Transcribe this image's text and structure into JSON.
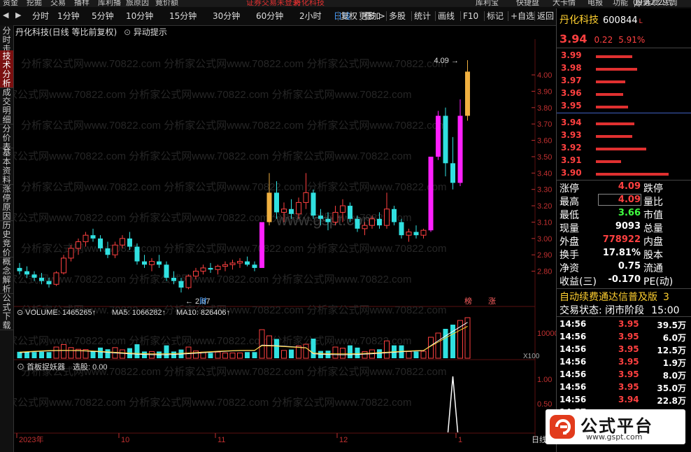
{
  "menu": [
    "资金",
    "挖掘",
    "交易",
    "播样",
    "库利播",
    "旅原因",
    "竟价额",
    "证券交易未登录",
    "丹化科技",
    "库利宝",
    "快捷盘",
    "大卡情",
    "电报",
    "功能",
    "服务",
    "公式",
    "选项",
    "09:42:29 周日"
  ],
  "toolbar": {
    "periods": [
      "分时",
      "1分钟",
      "5分钟",
      "10分钟",
      "15分钟",
      "30分钟",
      "60分钟",
      "2小时",
      "日线",
      "更多 >"
    ],
    "actions": [
      "复权",
      "叠加",
      "多股",
      "统计",
      "画线",
      "F10",
      "标记",
      "+自选",
      "返回"
    ],
    "active": "日线"
  },
  "left_tabs": [
    "分时走势",
    "技术分析",
    "成交明细",
    "分价表",
    "基本资料",
    "涨停原因",
    "历史竞价",
    "概念解析",
    "公式下载"
  ],
  "left_tabs_active": "技术分析",
  "chart": {
    "title": "丹化科技(日线 等比前复权)",
    "alert_label": "异动提示",
    "price_ticks": [
      "4.00",
      "3.90",
      "3.80",
      "3.70",
      "3.60",
      "3.50",
      "3.40",
      "3.30",
      "3.20",
      "3.10",
      "3.00",
      "2.90",
      "2.80"
    ],
    "high_marker": "4.09",
    "low_marker": "2.67",
    "finance_tag": "财",
    "tag_bang": "榜",
    "tag_zhang": "涨",
    "volume_title": "VOLUME: 1465265",
    "ma5": "MA5: 1066282",
    "ma10": "MA10: 826406",
    "volume_ticks": [
      "10000"
    ],
    "volume_unit": "X100",
    "indicator_title": "首板捉妖器",
    "indicator_value": "选股: 0.00",
    "indicator_ticks": [
      "1.00",
      "0.50"
    ],
    "x_labels": [
      "2023年",
      "10",
      "11",
      "12",
      "1"
    ],
    "x_right": "日线",
    "watermark": "分析家公式网www.70822.com",
    "watermark2": "www.gspt.com"
  },
  "chart_data": {
    "type": "candlestick",
    "title": "丹化科技(日线 等比前复权)",
    "ylim": [
      2.67,
      4.09
    ],
    "candles": [
      [
        2.82,
        2.85,
        2.78,
        2.8
      ],
      [
        2.8,
        2.83,
        2.76,
        2.78
      ],
      [
        2.78,
        2.8,
        2.74,
        2.76
      ],
      [
        2.76,
        2.79,
        2.72,
        2.74
      ],
      [
        2.74,
        2.76,
        2.7,
        2.72
      ],
      [
        2.72,
        2.8,
        2.71,
        2.79
      ],
      [
        2.79,
        2.9,
        2.78,
        2.88
      ],
      [
        2.88,
        2.96,
        2.86,
        2.94
      ],
      [
        2.94,
        3.0,
        2.9,
        2.98
      ],
      [
        2.98,
        3.04,
        2.95,
        3.02
      ],
      [
        3.02,
        3.06,
        2.98,
        3.0
      ],
      [
        3.0,
        3.02,
        2.92,
        2.94
      ],
      [
        2.94,
        2.98,
        2.88,
        2.9
      ],
      [
        2.9,
        2.98,
        2.88,
        2.96
      ],
      [
        2.96,
        3.02,
        2.94,
        3.0
      ],
      [
        3.0,
        3.04,
        2.93,
        2.95
      ],
      [
        2.95,
        2.97,
        2.84,
        2.86
      ],
      [
        2.86,
        2.9,
        2.82,
        2.84
      ],
      [
        2.84,
        2.88,
        2.8,
        2.86
      ],
      [
        2.86,
        2.9,
        2.82,
        2.84
      ],
      [
        2.84,
        2.86,
        2.74,
        2.76
      ],
      [
        2.76,
        2.8,
        2.72,
        2.74
      ],
      [
        2.74,
        2.76,
        2.67,
        2.7
      ],
      [
        2.7,
        2.78,
        2.69,
        2.77
      ],
      [
        2.77,
        2.82,
        2.75,
        2.8
      ],
      [
        2.8,
        2.84,
        2.78,
        2.82
      ],
      [
        2.82,
        2.85,
        2.79,
        2.81
      ],
      [
        2.81,
        2.84,
        2.78,
        2.83
      ],
      [
        2.83,
        2.86,
        2.8,
        2.84
      ],
      [
        2.84,
        2.87,
        2.81,
        2.85
      ],
      [
        2.85,
        2.88,
        2.82,
        2.86
      ],
      [
        2.86,
        2.89,
        2.83,
        2.84
      ],
      [
        2.84,
        2.86,
        2.8,
        2.82
      ],
      [
        2.82,
        2.9,
        2.82,
        3.1
      ],
      [
        3.1,
        3.4,
        3.08,
        3.28
      ],
      [
        3.28,
        3.35,
        3.12,
        3.16
      ],
      [
        3.16,
        3.22,
        3.1,
        3.18
      ],
      [
        3.18,
        3.24,
        3.12,
        3.15
      ],
      [
        3.15,
        3.25,
        3.12,
        3.22
      ],
      [
        3.22,
        3.4,
        3.18,
        3.28
      ],
      [
        3.28,
        3.3,
        3.12,
        3.14
      ],
      [
        3.14,
        3.18,
        3.08,
        3.12
      ],
      [
        3.12,
        3.16,
        3.05,
        3.1
      ],
      [
        3.1,
        3.2,
        3.08,
        3.16
      ],
      [
        3.16,
        3.24,
        3.1,
        3.2
      ],
      [
        3.2,
        3.22,
        3.1,
        3.12
      ],
      [
        3.12,
        3.14,
        3.04,
        3.06
      ],
      [
        3.06,
        3.1,
        3.02,
        3.08
      ],
      [
        3.08,
        3.14,
        3.06,
        3.12
      ],
      [
        3.12,
        3.16,
        3.06,
        3.08
      ],
      [
        3.08,
        3.28,
        3.06,
        3.18
      ],
      [
        3.18,
        3.2,
        3.08,
        3.1
      ],
      [
        3.1,
        3.12,
        3.0,
        3.02
      ],
      [
        3.02,
        3.06,
        2.98,
        3.04
      ],
      [
        3.04,
        3.08,
        3.0,
        3.02
      ],
      [
        3.02,
        3.06,
        3.0,
        3.05
      ],
      [
        3.05,
        3.5,
        3.04,
        3.5
      ],
      [
        3.5,
        3.78,
        3.48,
        3.75
      ],
      [
        3.75,
        3.8,
        3.38,
        3.46
      ],
      [
        3.46,
        3.62,
        3.3,
        3.34
      ],
      [
        3.34,
        3.85,
        3.32,
        3.75
      ],
      [
        3.75,
        4.09,
        3.72,
        4.02
      ]
    ],
    "volume_ma": [
      "MA5",
      "MA10"
    ]
  },
  "quote": {
    "name": "丹化科技",
    "code": "600844",
    "code_suffix": "L",
    "price": "3.94",
    "change": "0.22",
    "pct": "5.91%",
    "order_book": [
      {
        "price": "3.99",
        "w": 0.4
      },
      {
        "price": "3.98",
        "w": 0.45
      },
      {
        "price": "3.97",
        "w": 0.32
      },
      {
        "price": "3.96",
        "w": 0.3
      },
      {
        "price": "3.95",
        "w": 0.35
      },
      {
        "price": "3.94",
        "w": 0.42
      },
      {
        "price": "3.93",
        "w": 0.4
      },
      {
        "price": "3.92",
        "w": 0.55
      },
      {
        "price": "3.91",
        "w": 0.28
      },
      {
        "price": "3.90",
        "w": 0.8
      }
    ],
    "stats": [
      {
        "l1": "涨停",
        "v1": "4.09",
        "c1": "#ff4040",
        "l2": "跌停"
      },
      {
        "l1": "最高",
        "v1": "4.09",
        "c1": "#ff4040",
        "l2": "量比"
      },
      {
        "l1": "最低",
        "v1": "3.66",
        "c1": "#40ff40",
        "l2": "市值"
      },
      {
        "l1": "现量",
        "v1": "9093",
        "c1": "#ffffff",
        "l2": "总量"
      },
      {
        "l1": "外盘",
        "v1": "778922",
        "c1": "#ff4040",
        "l2": "内盘"
      },
      {
        "l1": "换手",
        "v1": "17.81%",
        "c1": "#ffffff",
        "l2": "股本"
      },
      {
        "l1": "净资",
        "v1": "0.75",
        "c1": "#ffffff",
        "l2": "流通"
      },
      {
        "l1": "收益(三)",
        "v1": "-0.170",
        "c1": "#ffffff",
        "l2": "PE(动)"
      }
    ],
    "promo": "自动续费通达信普及版",
    "promo_num": "3",
    "status_label": "交易状态: 闭市阶段",
    "status_time": "15:00",
    "ticks": [
      {
        "t": "14:56",
        "p": "3.95",
        "v": "39.5万"
      },
      {
        "t": "14:56",
        "p": "3.95",
        "v": "6.0万"
      },
      {
        "t": "14:56",
        "p": "3.95",
        "v": "12.5万"
      },
      {
        "t": "14:56",
        "p": "3.95",
        "v": "1.9万"
      },
      {
        "t": "14:56",
        "p": "3.95",
        "v": "8.0万"
      },
      {
        "t": "14:56",
        "p": "3.95",
        "v": "35.0万"
      },
      {
        "t": "14:56",
        "p": "3.94",
        "v": "22.8万"
      },
      {
        "t": "14:57",
        "p": "",
        "v": ""
      }
    ]
  },
  "logo": {
    "name": "公式平台",
    "url": "www.gspt.com"
  }
}
